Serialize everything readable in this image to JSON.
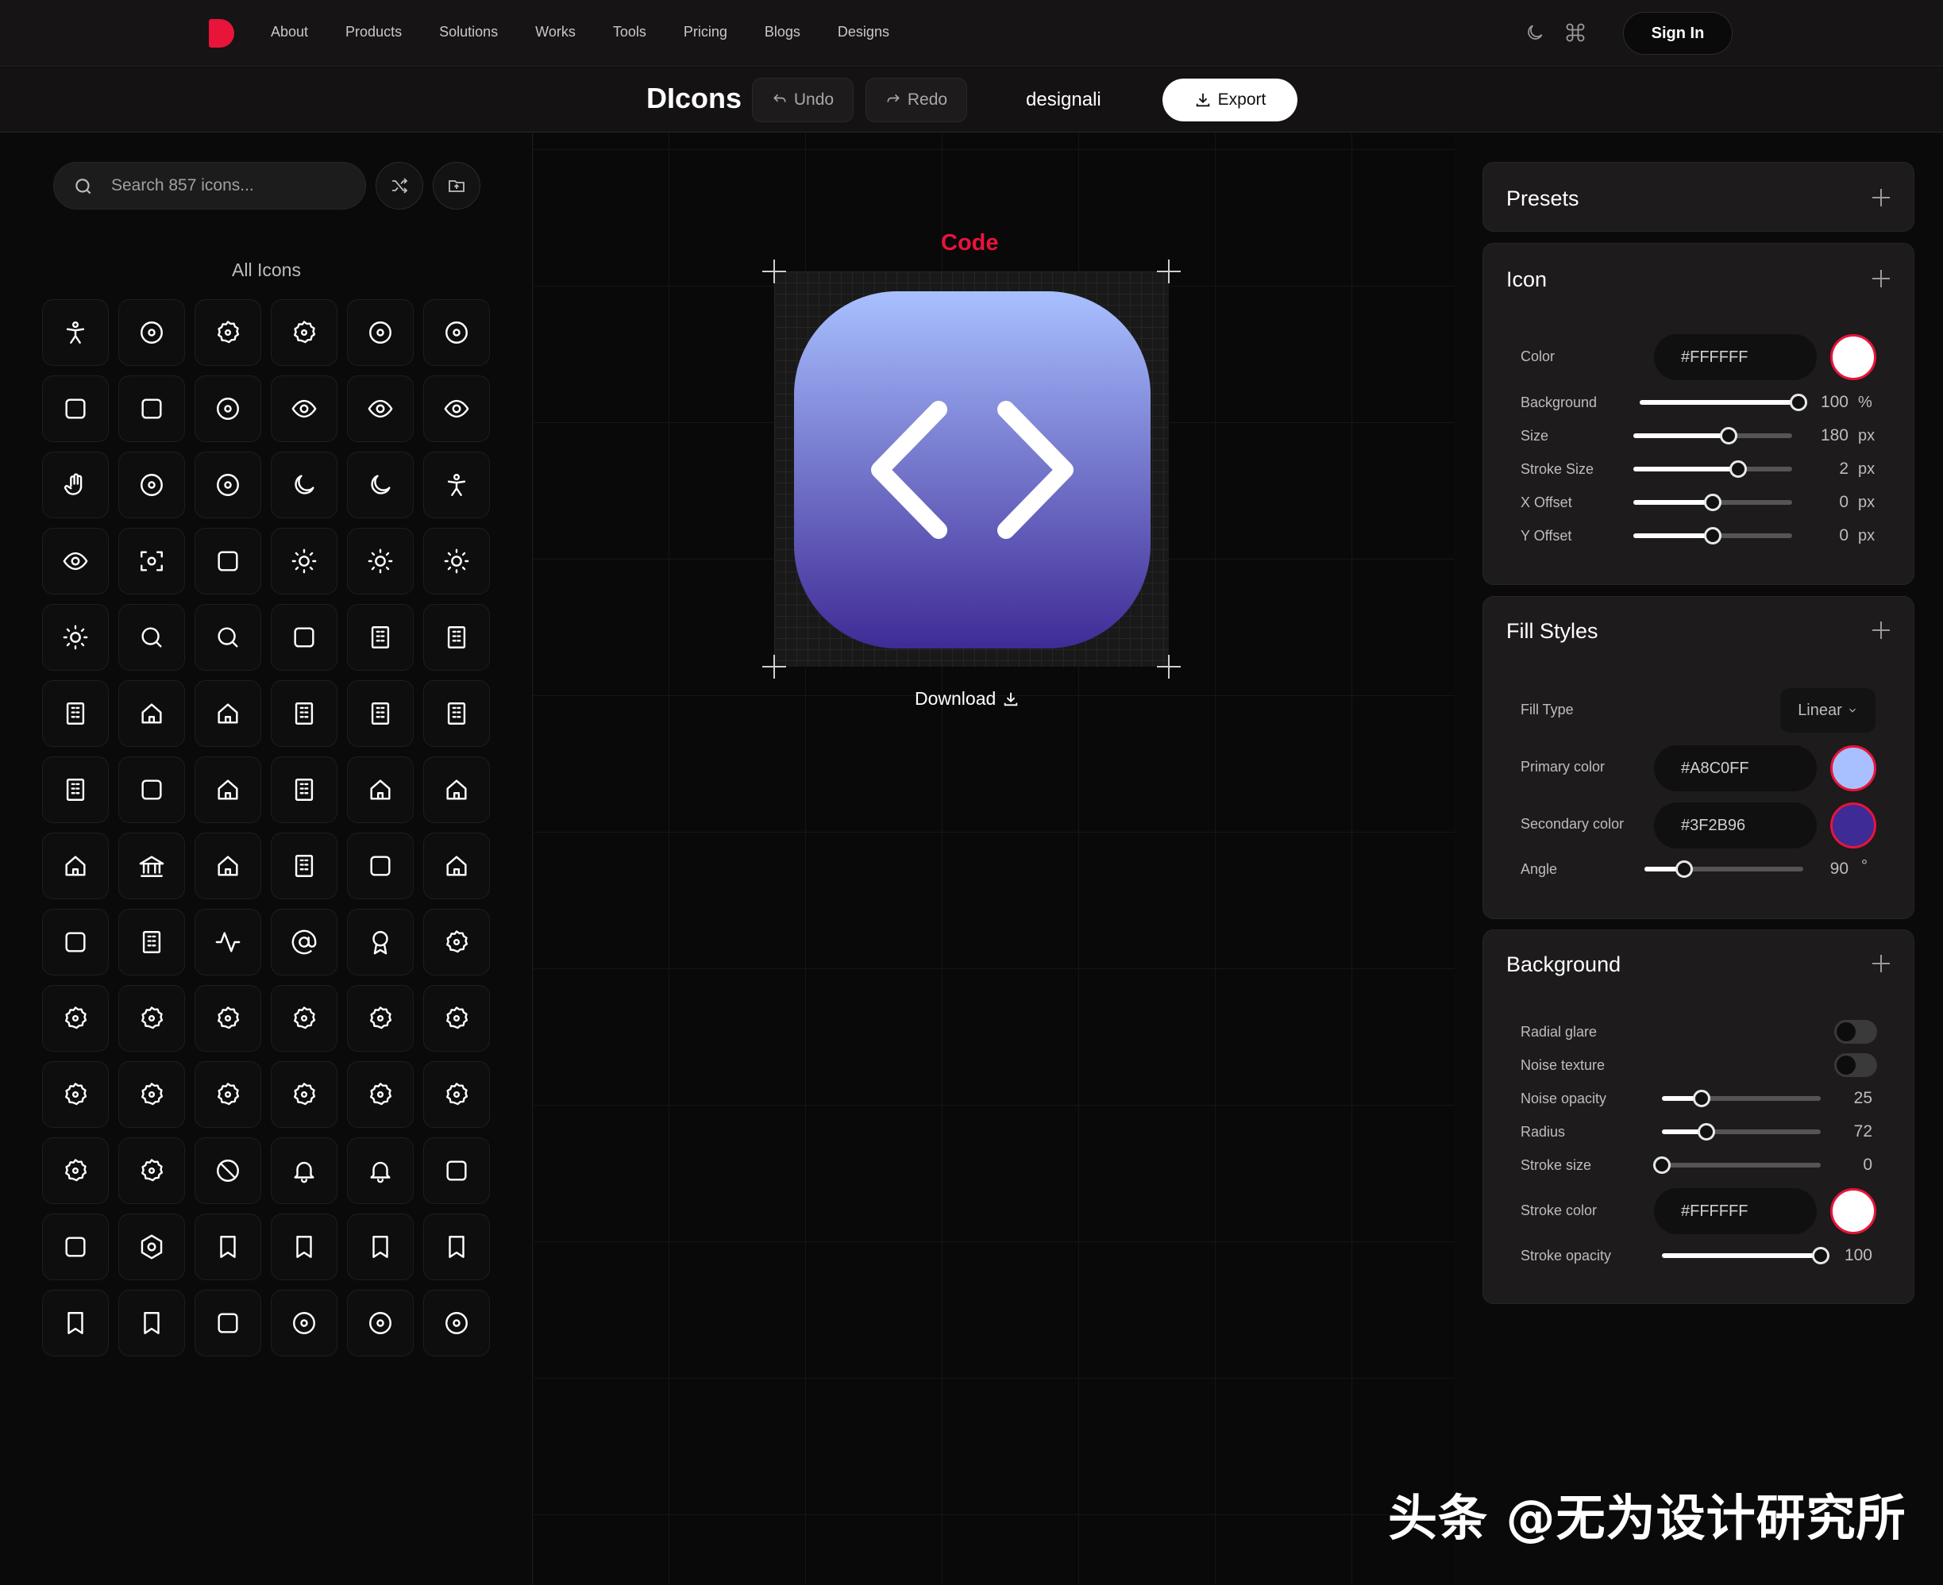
{
  "nav": {
    "links": [
      "About",
      "Products",
      "Solutions",
      "Works",
      "Tools",
      "Pricing",
      "Blogs",
      "Designs"
    ],
    "signin": "Sign In",
    "icons": [
      "moon-icon",
      "command-icon"
    ]
  },
  "toolbar": {
    "brand": "DIcons",
    "undo": "Undo",
    "redo": "Redo",
    "username": "designali",
    "export": "Export"
  },
  "sidebar": {
    "search_placeholder": "Search 857 icons...",
    "heading": "All Icons",
    "icons": [
      "accessibility-icon",
      "baby-icon",
      "badge-help-icon",
      "badge-info-icon",
      "help-circle-icon",
      "contrast-icon",
      "ear-icon",
      "ear-off-icon",
      "pie-chart-icon",
      "eye-icon",
      "eye-off-icon",
      "glasses-icon",
      "hand-icon",
      "info-icon",
      "life-buoy-icon",
      "moon-icon",
      "moon-star-icon",
      "person-standing-icon",
      "scan-eye-icon",
      "scan-search-icon",
      "speech-icon",
      "sun-icon",
      "sun-dim-icon",
      "sun-medium-icon",
      "sun-moon-icon",
      "zoom-in-icon",
      "zoom-out-icon",
      "anvil-icon",
      "brick-wall-icon",
      "building-icon",
      "building-2-icon",
      "castle-icon",
      "church-icon",
      "container-icon",
      "factory-icon",
      "factory-chart-icon",
      "fence-icon",
      "graduation-cap-icon",
      "hospital-icon",
      "hotel-icon",
      "house-icon",
      "house-plus-icon",
      "house-plug-icon",
      "landmark-icon",
      "school-icon",
      "store-icon",
      "tent-icon",
      "warehouse-icon",
      "utility-pole-icon",
      "garage-icon",
      "activity-icon",
      "at-sign-icon",
      "award-icon",
      "badge-icon",
      "badge-alert-icon",
      "badge-cent-icon",
      "badge-check-icon",
      "badge-dollar-icon",
      "badge-euro-icon",
      "badge-rupee-icon",
      "badge-yen-icon",
      "badge-minus-icon",
      "badge-percent-icon",
      "badge-plus-icon",
      "badge-pound-icon",
      "badge-ruble-icon",
      "badge-franc-icon",
      "badge-x-icon",
      "ban-icon",
      "bell-icon",
      "bell-dot-icon",
      "between-icon",
      "indent-icon",
      "hexagon-icon",
      "book-user-icon",
      "bookmark-check-icon",
      "bookmark-icon",
      "bookmark-plus-icon",
      "bookmark-x-icon",
      "contact-icon",
      "cake-icon",
      "gauge-icon",
      "circle-percent-icon",
      "circle-user-icon"
    ]
  },
  "canvas": {
    "label": "Code",
    "download": "Download"
  },
  "presets": {
    "title": "Presets"
  },
  "icon_panel": {
    "title": "Icon",
    "color_label": "Color",
    "color_value": "#FFFFFF",
    "background_label": "Background",
    "background_value": "100",
    "background_unit": "%",
    "size_label": "Size",
    "size_value": "180",
    "stroke_label": "Stroke Size",
    "stroke_value": "2",
    "xoff_label": "X Offset",
    "xoff_value": "0",
    "yoff_label": "Y Offset",
    "yoff_value": "0",
    "px": "px",
    "levels": {
      "background": 1.0,
      "size": 0.6,
      "stroke": 0.66,
      "xoff": 0.5,
      "yoff": 0.5
    }
  },
  "fill_styles": {
    "title": "Fill Styles",
    "type_label": "Fill Type",
    "type_value": "Linear",
    "primary_label": "Primary color",
    "primary_value": "#A8C0FF",
    "secondary_label": "Secondary color",
    "secondary_value": "#3F2B96",
    "angle_label": "Angle",
    "angle_value": "90",
    "angle_unit": "°",
    "angle_level": 0.25
  },
  "background_panel": {
    "title": "Background",
    "radial_label": "Radial glare",
    "noise_label": "Noise texture",
    "noise_opacity_label": "Noise opacity",
    "noise_opacity_value": "25",
    "radius_label": "Radius",
    "radius_value": "72",
    "stroke_size_label": "Stroke size",
    "stroke_size_value": "0",
    "stroke_color_label": "Stroke color",
    "stroke_color_value": "#FFFFFF",
    "stroke_opacity_label": "Stroke opacity",
    "stroke_opacity_value": "100",
    "levels": {
      "noise_opacity": 0.25,
      "radius": 0.28,
      "stroke_size": 0.0,
      "stroke_opacity": 1.0
    }
  },
  "colors": {
    "accent": "#e8143a",
    "primary": "#a8c0ff",
    "secondary": "#3f2b96",
    "white": "#ffffff"
  },
  "watermark": "头条 @无为设计研究所"
}
